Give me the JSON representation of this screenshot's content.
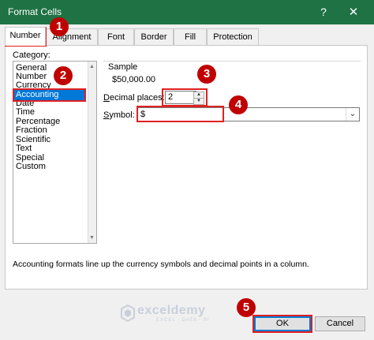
{
  "window": {
    "title": "Format Cells",
    "help": "?",
    "close": "✕"
  },
  "tabs": [
    "Number",
    "Alignment",
    "Font",
    "Border",
    "Fill",
    "Protection"
  ],
  "category": {
    "label": "Category:",
    "items": [
      "General",
      "Number",
      "Currency",
      "Accounting",
      "Date",
      "Time",
      "Percentage",
      "Fraction",
      "Scientific",
      "Text",
      "Special",
      "Custom"
    ],
    "selected": "Accounting"
  },
  "sample": {
    "label": "Sample",
    "value": "$50,000.00"
  },
  "decimal": {
    "label_underlined": "D",
    "label_rest": "ecimal places:",
    "value": "2"
  },
  "symbol": {
    "label_underlined": "S",
    "label_rest": "ymbol:",
    "value": "$"
  },
  "description": "Accounting formats line up the currency symbols and decimal points in a column.",
  "buttons": {
    "ok": "OK",
    "cancel": "Cancel"
  },
  "annotations": [
    "1",
    "2",
    "3",
    "4",
    "5"
  ],
  "watermark": {
    "name": "exceldemy",
    "tagline": "EXCEL · DATA · BI"
  },
  "colors": {
    "titlebar": "#1f7244",
    "selection": "#0078d7",
    "annotation": "#c00000"
  }
}
